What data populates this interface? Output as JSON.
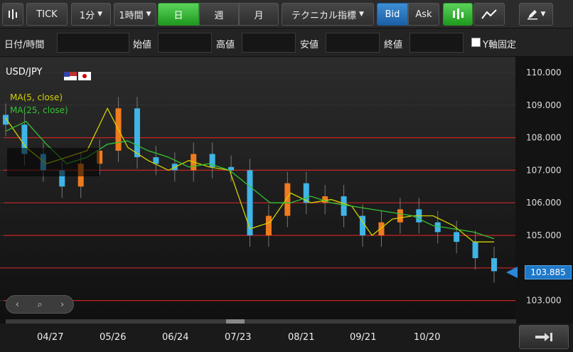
{
  "toolbar": {
    "chart_type_icon": "candlestick-icon",
    "tick_label": "TICK",
    "interval_1m": "1分",
    "interval_1h": "1時間",
    "period_day": "日",
    "period_week": "週",
    "period_month": "月",
    "technical_label": "テクニカル指標",
    "bid_label": "Bid",
    "ask_label": "Ask",
    "candle_icon": "candlestick-icon",
    "line_icon": "line-chart-icon",
    "draw_icon": "pen-icon"
  },
  "ohlc": {
    "datetime_label": "日付/時間",
    "open_label": "始値",
    "high_label": "高値",
    "low_label": "安値",
    "close_label": "終値",
    "yaxis_fix_label": "Y軸固定"
  },
  "chart": {
    "symbol": "USD/JPY",
    "ma5_label": "MA(5, close)",
    "ma25_label": "MA(25, close)",
    "current_price": "103.885",
    "y_ticks": [
      "110.000",
      "109.000",
      "108.000",
      "107.000",
      "106.000",
      "105.000",
      "104.000",
      "103.000"
    ],
    "x_ticks": [
      "04/27",
      "05/26",
      "06/24",
      "07/23",
      "08/21",
      "09/21",
      "10/20"
    ],
    "colors": {
      "up": "#f07b1e",
      "down": "#3fb4e6",
      "ma5": "#d2d200",
      "ma25": "#33c333",
      "hline": "#c62424",
      "price_tag": "#1e78c8"
    }
  },
  "chart_data": {
    "type": "candlestick",
    "title": "USD/JPY",
    "ylim": [
      102.7,
      110.4
    ],
    "x": [
      "04/27",
      "05/26",
      "06/24",
      "07/23",
      "08/21",
      "09/21",
      "10/20"
    ],
    "series": [
      {
        "name": "MA(5, close)",
        "values": [
          108.6,
          107.7,
          107.2,
          107.4,
          107.6,
          108.9,
          107.7,
          107.3,
          107.0,
          107.3,
          107.1,
          107.0,
          105.2,
          105.4,
          106.3,
          106.0,
          106.1,
          105.9,
          105.0,
          105.5,
          105.6,
          105.6,
          105.3,
          104.8,
          104.8
        ]
      },
      {
        "name": "MA(25, close)",
        "values": [
          108.2,
          108.5,
          107.8,
          107.2,
          107.4,
          107.8,
          107.9,
          107.6,
          107.4,
          107.1,
          107.2,
          107.0,
          106.5,
          106.0,
          106.0,
          106.2,
          106.0,
          105.9,
          105.8,
          105.7,
          105.6,
          105.3,
          105.2,
          105.1,
          104.9
        ]
      },
      {
        "name": "close",
        "values": [
          108.4,
          107.5,
          107.0,
          106.5,
          107.2,
          107.6,
          108.9,
          107.4,
          107.2,
          107.0,
          107.5,
          107.1,
          107.0,
          105.0,
          105.6,
          106.6,
          106.0,
          106.2,
          105.6,
          105.0,
          105.4,
          105.8,
          105.4,
          105.1,
          104.8,
          104.3,
          103.9
        ]
      }
    ],
    "reference_lines": [
      108.0,
      107.0,
      106.0,
      105.0,
      104.0,
      103.0
    ],
    "current_price": 103.885
  }
}
